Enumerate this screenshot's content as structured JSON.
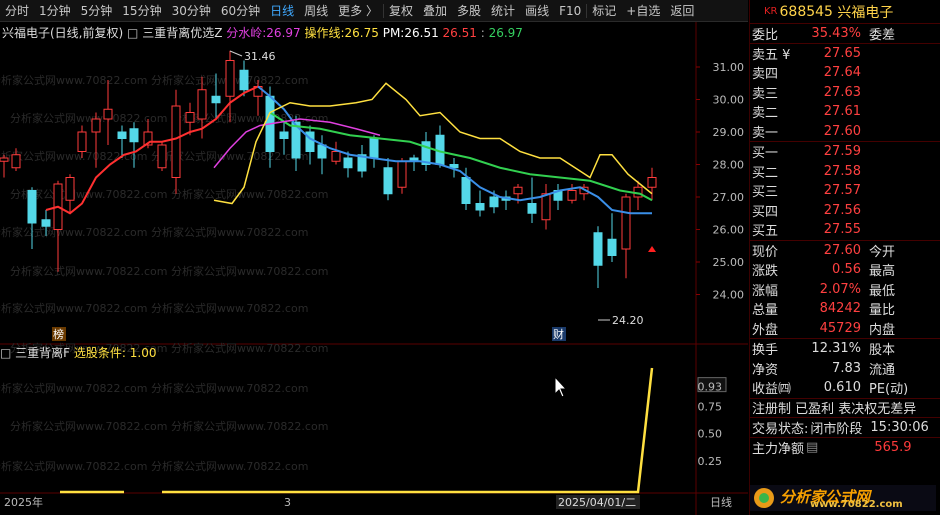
{
  "toolbar": {
    "items": [
      "分时",
      "1分钟",
      "5分钟",
      "15分钟",
      "30分钟",
      "60分钟",
      "日线",
      "周线",
      "更多 〉",
      "复权",
      "叠加",
      "多股",
      "统计",
      "画线",
      "F10",
      "标记",
      "+自选",
      "返回"
    ],
    "active": "日线"
  },
  "header": {
    "stock": "兴福电子(日线,前复权)",
    "indicator": "三重背离优选Z",
    "fsl_label": "分水岭:",
    "fsl": "26.97",
    "czx_label": "操作线:",
    "czx": "26.75",
    "pm_label": "PM:",
    "pm": "26.51",
    "v1": "26.51",
    "v2": "26.97"
  },
  "watermark": "分析家公式网www.70822.com",
  "price_axis": [
    "31.00",
    "30.00",
    "29.00",
    "28.00",
    "27.00",
    "26.00",
    "25.00",
    "24.00"
  ],
  "annot": {
    "high": "31.46",
    "low": "24.20",
    "bang": "榜",
    "cai": "财"
  },
  "indicator": {
    "name": "三重背离F",
    "cond_label": "选股条件:",
    "cond": "1.00"
  },
  "ind_axis": [
    "0.93",
    "0.75",
    "0.50",
    "0.25"
  ],
  "xaxis": {
    "start": "2025年",
    "mid": "3",
    "date": "2025/04/01/二",
    "end": "日线"
  },
  "quote": {
    "kr": "KR",
    "code": "688545",
    "name": "兴福电子",
    "webi_label": "委比",
    "webi": "35.43%",
    "wc_label": "委差",
    "asks": [
      {
        "l": "卖五",
        "v": "27.65",
        "m": "¥"
      },
      {
        "l": "卖四",
        "v": "27.64",
        "m": ""
      },
      {
        "l": "卖三",
        "v": "27.63",
        "m": ""
      },
      {
        "l": "卖二",
        "v": "27.61",
        "m": ""
      },
      {
        "l": "卖一",
        "v": "27.60",
        "m": ""
      }
    ],
    "bids": [
      {
        "l": "买一",
        "v": "27.59"
      },
      {
        "l": "买二",
        "v": "27.58"
      },
      {
        "l": "买三",
        "v": "27.57"
      },
      {
        "l": "买四",
        "v": "27.56"
      },
      {
        "l": "买五",
        "v": "27.55"
      }
    ],
    "stats": [
      {
        "l": "现价",
        "v": "27.60",
        "r": "今开"
      },
      {
        "l": "涨跌",
        "v": "0.56",
        "r": "最高"
      },
      {
        "l": "涨幅",
        "v": "2.07%",
        "r": "最低"
      },
      {
        "l": "总量",
        "v": "84242",
        "r": "量比"
      },
      {
        "l": "外盘",
        "v": "45729",
        "r": "内盘"
      }
    ],
    "stats2": [
      {
        "l": "换手",
        "v": "12.31%",
        "r": "股本"
      },
      {
        "l": "净资",
        "v": "7.83",
        "r": "流通"
      },
      {
        "l": "收益㈣",
        "v": "0.610",
        "r": "PE(动)"
      }
    ],
    "tags": "注册制 已盈利 表决权无差异",
    "status_label": "交易状态:",
    "status": "闭市阶段",
    "time": "15:30:06",
    "net_label": "主力净额",
    "net": "565.9"
  },
  "badge": {
    "text": "分析家公式网",
    "url": "www.70822.com"
  }
}
